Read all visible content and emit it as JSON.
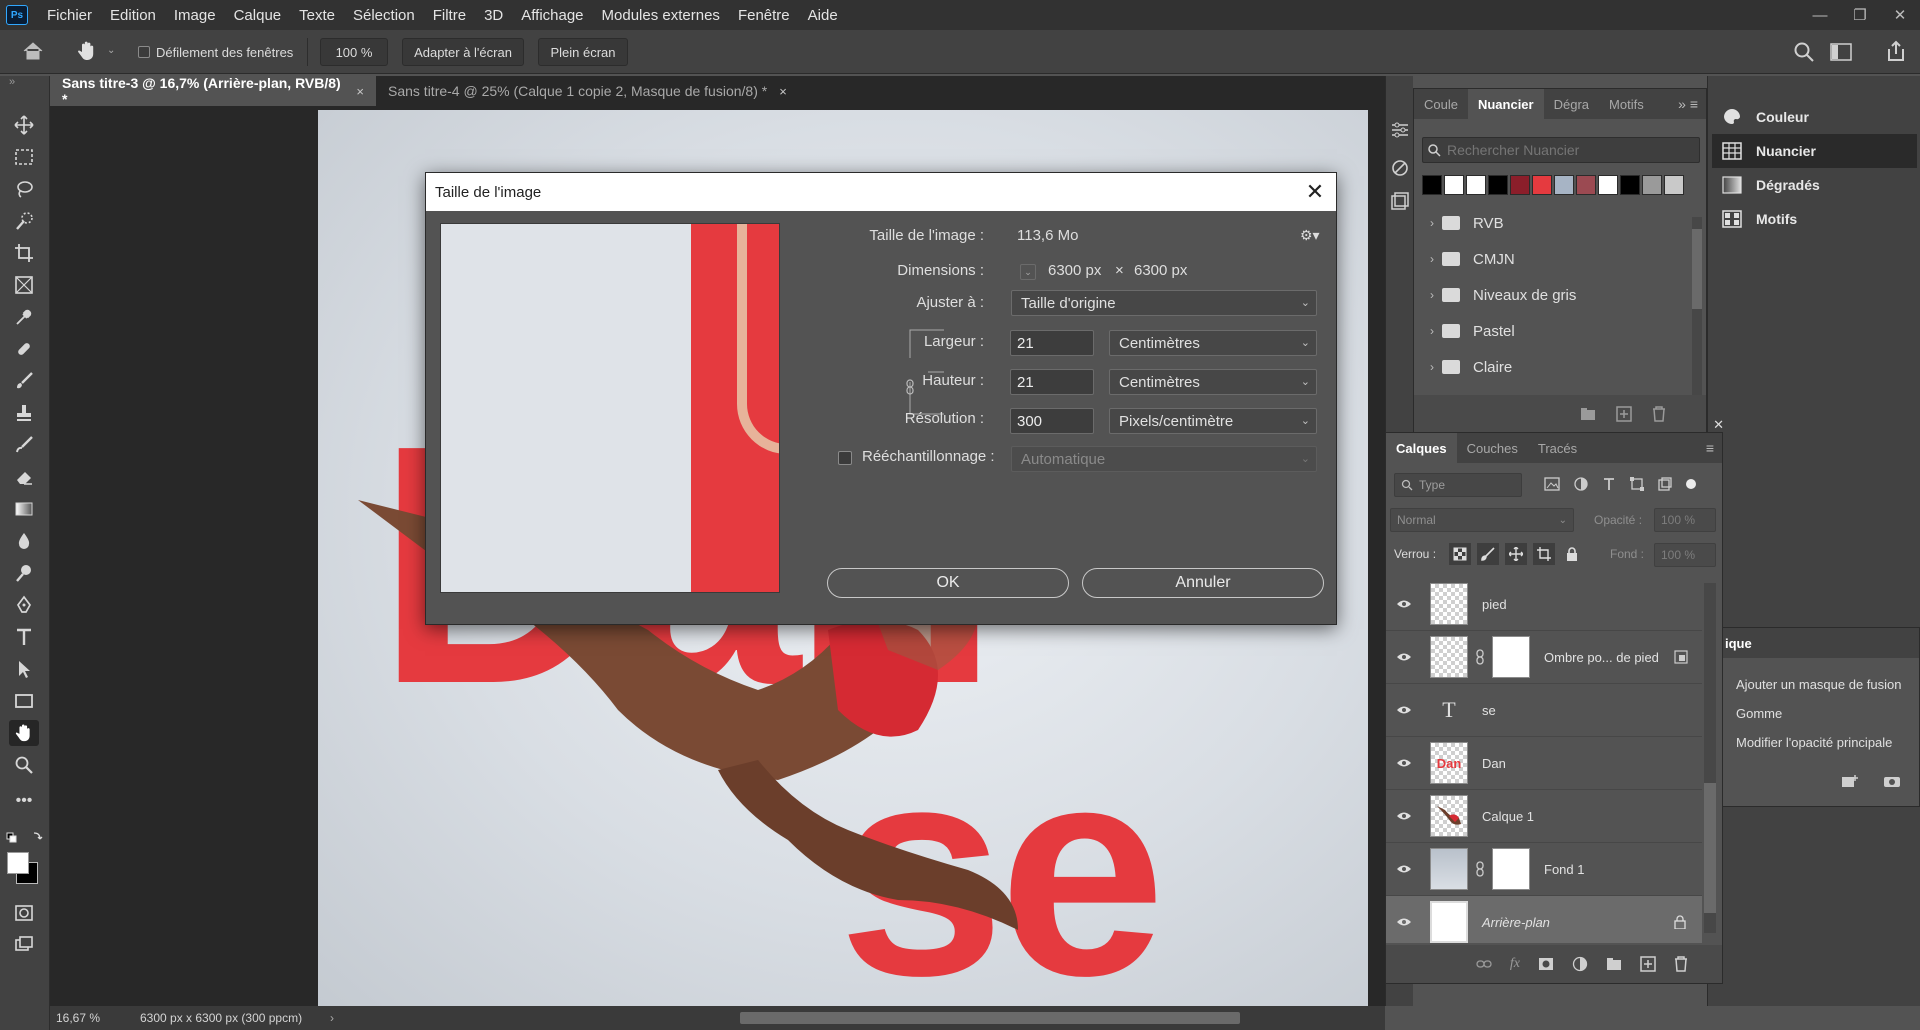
{
  "app": {
    "logo": "Ps"
  },
  "menu": [
    "Fichier",
    "Edition",
    "Image",
    "Calque",
    "Texte",
    "Sélection",
    "Filtre",
    "3D",
    "Affichage",
    "Modules externes",
    "Fenêtre",
    "Aide"
  ],
  "window_controls": {
    "minimize": "—",
    "restore": "❐",
    "close": "✕"
  },
  "options_bar": {
    "scroll_all_windows": "Défilement des fenêtres",
    "zoom": "100 %",
    "fit_screen": "Adapter à l'écran",
    "full_screen": "Plein écran"
  },
  "tabs": [
    {
      "label": "Sans titre-3 @ 16,7% (Arrière-plan, RVB/8) *",
      "active": true
    },
    {
      "label": "Sans titre-4 @ 25% (Calque 1 copie 2, Masque de fusion/8) *",
      "active": false
    }
  ],
  "tab_close": "×",
  "canvas": {
    "text_top": "Dan",
    "text_bottom": "se"
  },
  "status": {
    "zoom": "16,67 %",
    "info": "6300 px x 6300 px (300 ppcm)",
    "arrow": "›"
  },
  "dialog": {
    "title": "Taille de l'image",
    "close": "✕",
    "image_size_label": "Taille de l'image :",
    "image_size_value": "113,6 Mo",
    "dimensions_label": "Dimensions :",
    "dimensions_w": "6300 px",
    "dimensions_x": "×",
    "dimensions_h": "6300 px",
    "fit_label": "Ajuster à :",
    "fit_value": "Taille d'origine",
    "width_label": "Largeur :",
    "width_value": "21",
    "width_unit": "Centimètres",
    "height_label": "Hauteur :",
    "height_value": "21",
    "height_unit": "Centimètres",
    "resolution_label": "Résolution :",
    "resolution_value": "300",
    "resolution_unit": "Pixels/centimètre",
    "resample_label": "Rééchantillonnage :",
    "resample_value": "Automatique",
    "ok": "OK",
    "cancel": "Annuler"
  },
  "swatches_panel": {
    "tabs": [
      "Coule",
      "Nuancier",
      "Dégra",
      "Motifs"
    ],
    "search_placeholder": "Rechercher Nuancier",
    "colors": [
      "#000000",
      "#ffffff",
      "#ffffff",
      "#000000",
      "#8b1e2a",
      "#e53a3f",
      "#a7b4c5",
      "#9b4a52",
      "#ffffff",
      "#000000",
      "#9a9a9a",
      "#c9c9c9"
    ],
    "folders": [
      "RVB",
      "CMJN",
      "Niveaux de gris",
      "Pastel",
      "Claire"
    ]
  },
  "right_panel": {
    "items": [
      {
        "label": "Couleur",
        "icon": "color-wheel-icon"
      },
      {
        "label": "Nuancier",
        "icon": "swatches-grid-icon"
      },
      {
        "label": "Dégradés",
        "icon": "gradient-icon"
      },
      {
        "label": "Motifs",
        "icon": "patterns-icon"
      }
    ]
  },
  "history_panel": {
    "title": "ique",
    "rows": [
      "Ajouter un masque de fusion",
      "Gomme",
      "Modifier l'opacité principale"
    ]
  },
  "layers_panel": {
    "tabs": [
      "Calques",
      "Couches",
      "Tracés"
    ],
    "filter": "Type",
    "blend_mode": "Normal",
    "opacity_label": "Opacité :",
    "opacity_value": "100 %",
    "lock_label": "Verrou :",
    "fill_label": "Fond :",
    "fill_value": "100 %",
    "layers": [
      {
        "name": "pied"
      },
      {
        "name": "Ombre po... de pied"
      },
      {
        "name": "se"
      },
      {
        "name": "Dan"
      },
      {
        "name": "Calque 1"
      },
      {
        "name": "Fond 1"
      },
      {
        "name": "Arrière-plan"
      }
    ],
    "thumb_text_T": "T",
    "thumb_text_dan": "Dan"
  }
}
